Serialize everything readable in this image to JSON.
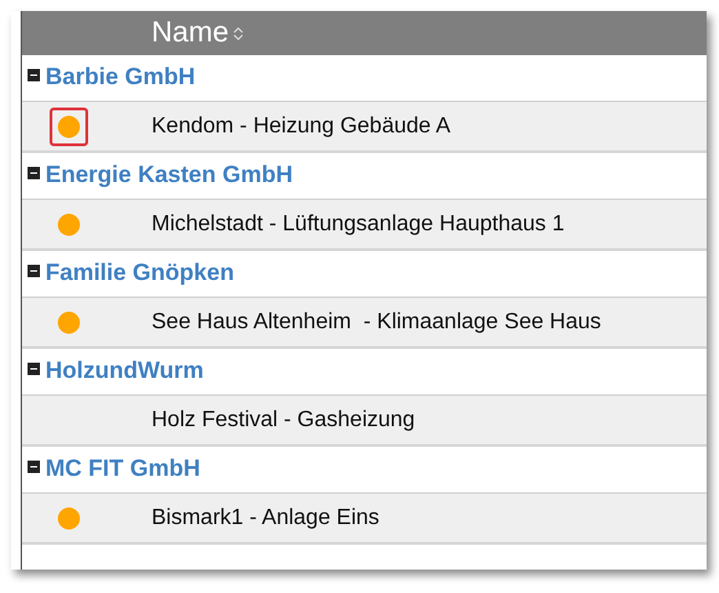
{
  "table": {
    "columns": [
      {
        "label": "Name",
        "sort_icon": true
      }
    ],
    "groups": [
      {
        "name": "Barbie GmbH",
        "expanded": true,
        "items": [
          {
            "label": "Kendom - Heizung Gebäude A",
            "dot": true,
            "selected": true
          }
        ]
      },
      {
        "name": "Energie Kasten GmbH",
        "expanded": true,
        "items": [
          {
            "label": "Michelstadt - Lüftungsanlage Haupthaus 1",
            "dot": true,
            "selected": false
          }
        ]
      },
      {
        "name": "Familie Gnöpken",
        "expanded": true,
        "items": [
          {
            "label": "See Haus Altenheim  - Klimaanlage See Haus",
            "dot": true,
            "selected": false
          }
        ]
      },
      {
        "name": "HolzundWurm",
        "expanded": true,
        "items": [
          {
            "label": "Holz Festival - Gasheizung",
            "dot": false,
            "selected": false
          }
        ]
      },
      {
        "name": "MC FIT GmbH",
        "expanded": true,
        "items": [
          {
            "label": "Bismark1 - Anlage Eins",
            "dot": true,
            "selected": false
          }
        ]
      }
    ]
  }
}
